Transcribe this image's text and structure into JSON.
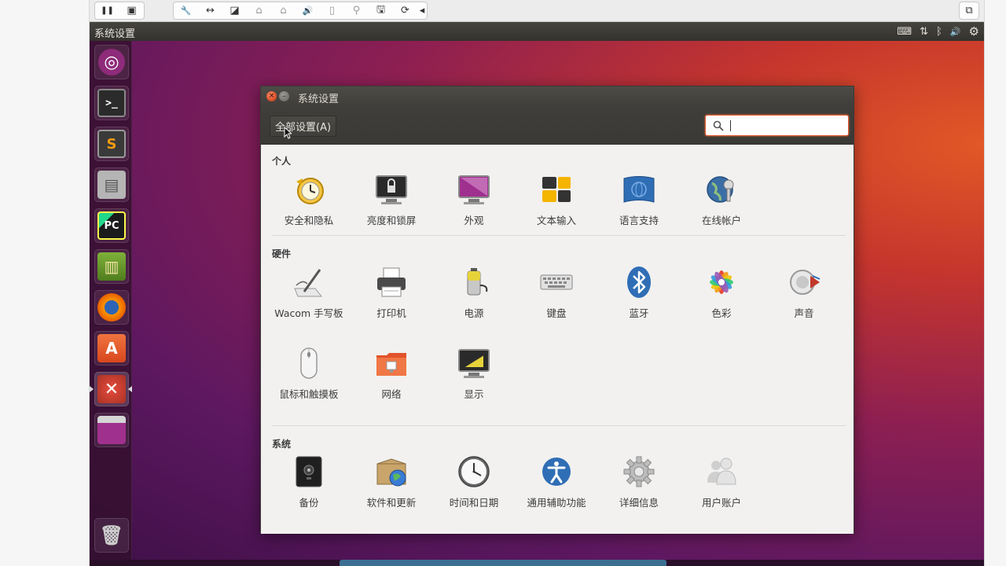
{
  "host": {
    "toolbar": {
      "group1": [
        {
          "name": "pause-icon",
          "glyph": "❚❚"
        },
        {
          "name": "snapshot-icon",
          "glyph": "▣"
        }
      ],
      "group2": [
        {
          "name": "wrench-icon",
          "glyph": "🔧"
        },
        {
          "name": "resize-arrows-icon",
          "glyph": "↔"
        },
        {
          "name": "disk-icon",
          "glyph": "◪"
        },
        {
          "name": "lock-icon",
          "glyph": "⌂"
        },
        {
          "name": "lock-alt-icon",
          "glyph": "⌂"
        },
        {
          "name": "speaker-icon",
          "glyph": "🔊"
        },
        {
          "name": "phone-icon",
          "glyph": "▯"
        },
        {
          "name": "usb-icon",
          "glyph": "⚲"
        },
        {
          "name": "save-icon",
          "glyph": "🖫"
        },
        {
          "name": "refresh-icon",
          "glyph": "⟳"
        },
        {
          "name": "collapse-arrow-icon",
          "glyph": "◂"
        }
      ],
      "restore_glyph": "⧉"
    }
  },
  "panel": {
    "title": "系统设置",
    "indicators": [
      {
        "name": "keyboard-indicator-icon",
        "glyph": "⌨"
      },
      {
        "name": "network-indicator-icon",
        "glyph": "⇅"
      },
      {
        "name": "bluetooth-indicator-icon",
        "glyph": "ᛒ"
      },
      {
        "name": "volume-indicator-icon",
        "glyph": "🔊"
      },
      {
        "name": "system-gear-icon",
        "glyph": "⚙"
      }
    ]
  },
  "launcher": {
    "items": [
      {
        "name": "dash-home-icon",
        "glyph": "◎",
        "color": "#8e2b7a"
      },
      {
        "name": "terminal-icon",
        "glyph": ">_",
        "color": "#2b2b2b"
      },
      {
        "name": "sublime-text-icon",
        "glyph": "S",
        "color": "#3a3a3a"
      },
      {
        "name": "file-manager-icon",
        "glyph": "▤",
        "color": "#9a9a9a"
      },
      {
        "name": "pycharm-icon",
        "glyph": "PC",
        "color": "#1b1b1b"
      },
      {
        "name": "book-reader-icon",
        "glyph": "▥",
        "color": "#5d8b2a"
      },
      {
        "name": "firefox-icon",
        "glyph": "●",
        "color": "#e66000"
      },
      {
        "name": "software-center-icon",
        "glyph": "A",
        "color": "#e2532a"
      },
      {
        "name": "system-settings-icon",
        "glyph": "✕",
        "color": "#c0392b"
      },
      {
        "name": "workspace-switcher-icon",
        "glyph": "▭",
        "color": "#a0308e"
      }
    ],
    "trash": {
      "name": "trash-icon",
      "glyph": "🗑"
    }
  },
  "window": {
    "title": "系统设置",
    "close_glyph": "×",
    "minimize_glyph": "–",
    "all_settings_label": "全部设置(A)",
    "search": {
      "value": "",
      "placeholder": ""
    },
    "sections": [
      {
        "title": "个人",
        "items": [
          {
            "label": "安全和隐私",
            "icon": "security-privacy-icon"
          },
          {
            "label": "亮度和锁屏",
            "icon": "brightness-lock-icon"
          },
          {
            "label": "外观",
            "icon": "appearance-icon"
          },
          {
            "label": "文本输入",
            "icon": "text-entry-icon"
          },
          {
            "label": "语言支持",
            "icon": "language-support-icon"
          },
          {
            "label": "在线帐户",
            "icon": "online-accounts-icon"
          }
        ]
      },
      {
        "title": "硬件",
        "items": [
          {
            "label": "Wacom 手写板",
            "icon": "wacom-tablet-icon"
          },
          {
            "label": "打印机",
            "icon": "printer-icon"
          },
          {
            "label": "电源",
            "icon": "power-icon"
          },
          {
            "label": "键盘",
            "icon": "keyboard-icon"
          },
          {
            "label": "蓝牙",
            "icon": "bluetooth-icon"
          },
          {
            "label": "色彩",
            "icon": "color-icon"
          },
          {
            "label": "声音",
            "icon": "sound-icon"
          },
          {
            "label": "鼠标和触摸板",
            "icon": "mouse-touchpad-icon"
          },
          {
            "label": "网络",
            "icon": "network-icon"
          },
          {
            "label": "显示",
            "icon": "displays-icon"
          }
        ]
      },
      {
        "title": "系统",
        "items": [
          {
            "label": "备份",
            "icon": "backup-icon"
          },
          {
            "label": "软件和更新",
            "icon": "software-updates-icon"
          },
          {
            "label": "时间和日期",
            "icon": "time-date-icon"
          },
          {
            "label": "通用辅助功能",
            "icon": "universal-access-icon"
          },
          {
            "label": "详细信息",
            "icon": "details-icon"
          },
          {
            "label": "用户账户",
            "icon": "user-accounts-icon"
          }
        ]
      }
    ]
  },
  "colors": {
    "accent": "#e4572e",
    "panel_bg": "#3d3c37",
    "window_bg": "#f2f1f0"
  }
}
